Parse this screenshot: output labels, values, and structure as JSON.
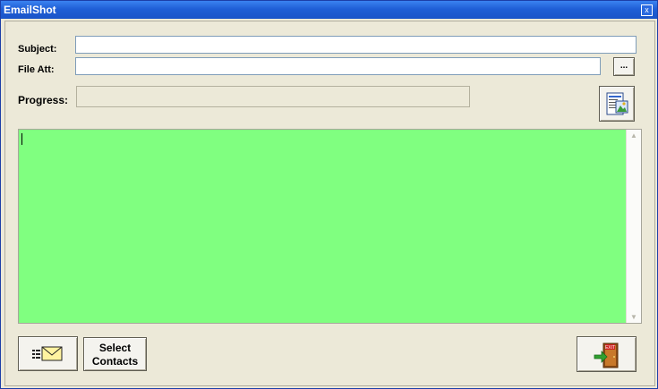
{
  "window": {
    "title": "EmailShot",
    "close_icon": "close-icon"
  },
  "form": {
    "subject_label": "Subject:",
    "subject_value": "",
    "file_att_label": "File Att:",
    "file_att_value": "",
    "browse_label": "...",
    "progress_label": "Progress:",
    "progress_fraction": 0
  },
  "message_body": {
    "text": "",
    "background_color": "#80ff80"
  },
  "buttons": {
    "preview_icon": "document-preview-icon",
    "send_icon": "envelope-send-icon",
    "select_contacts_label_line1": "Select",
    "select_contacts_label_line2": "Contacts",
    "exit_icon": "exit-door-icon"
  },
  "colors": {
    "titlebar": "#1f5fd6",
    "window_bg": "#ece9d8"
  }
}
